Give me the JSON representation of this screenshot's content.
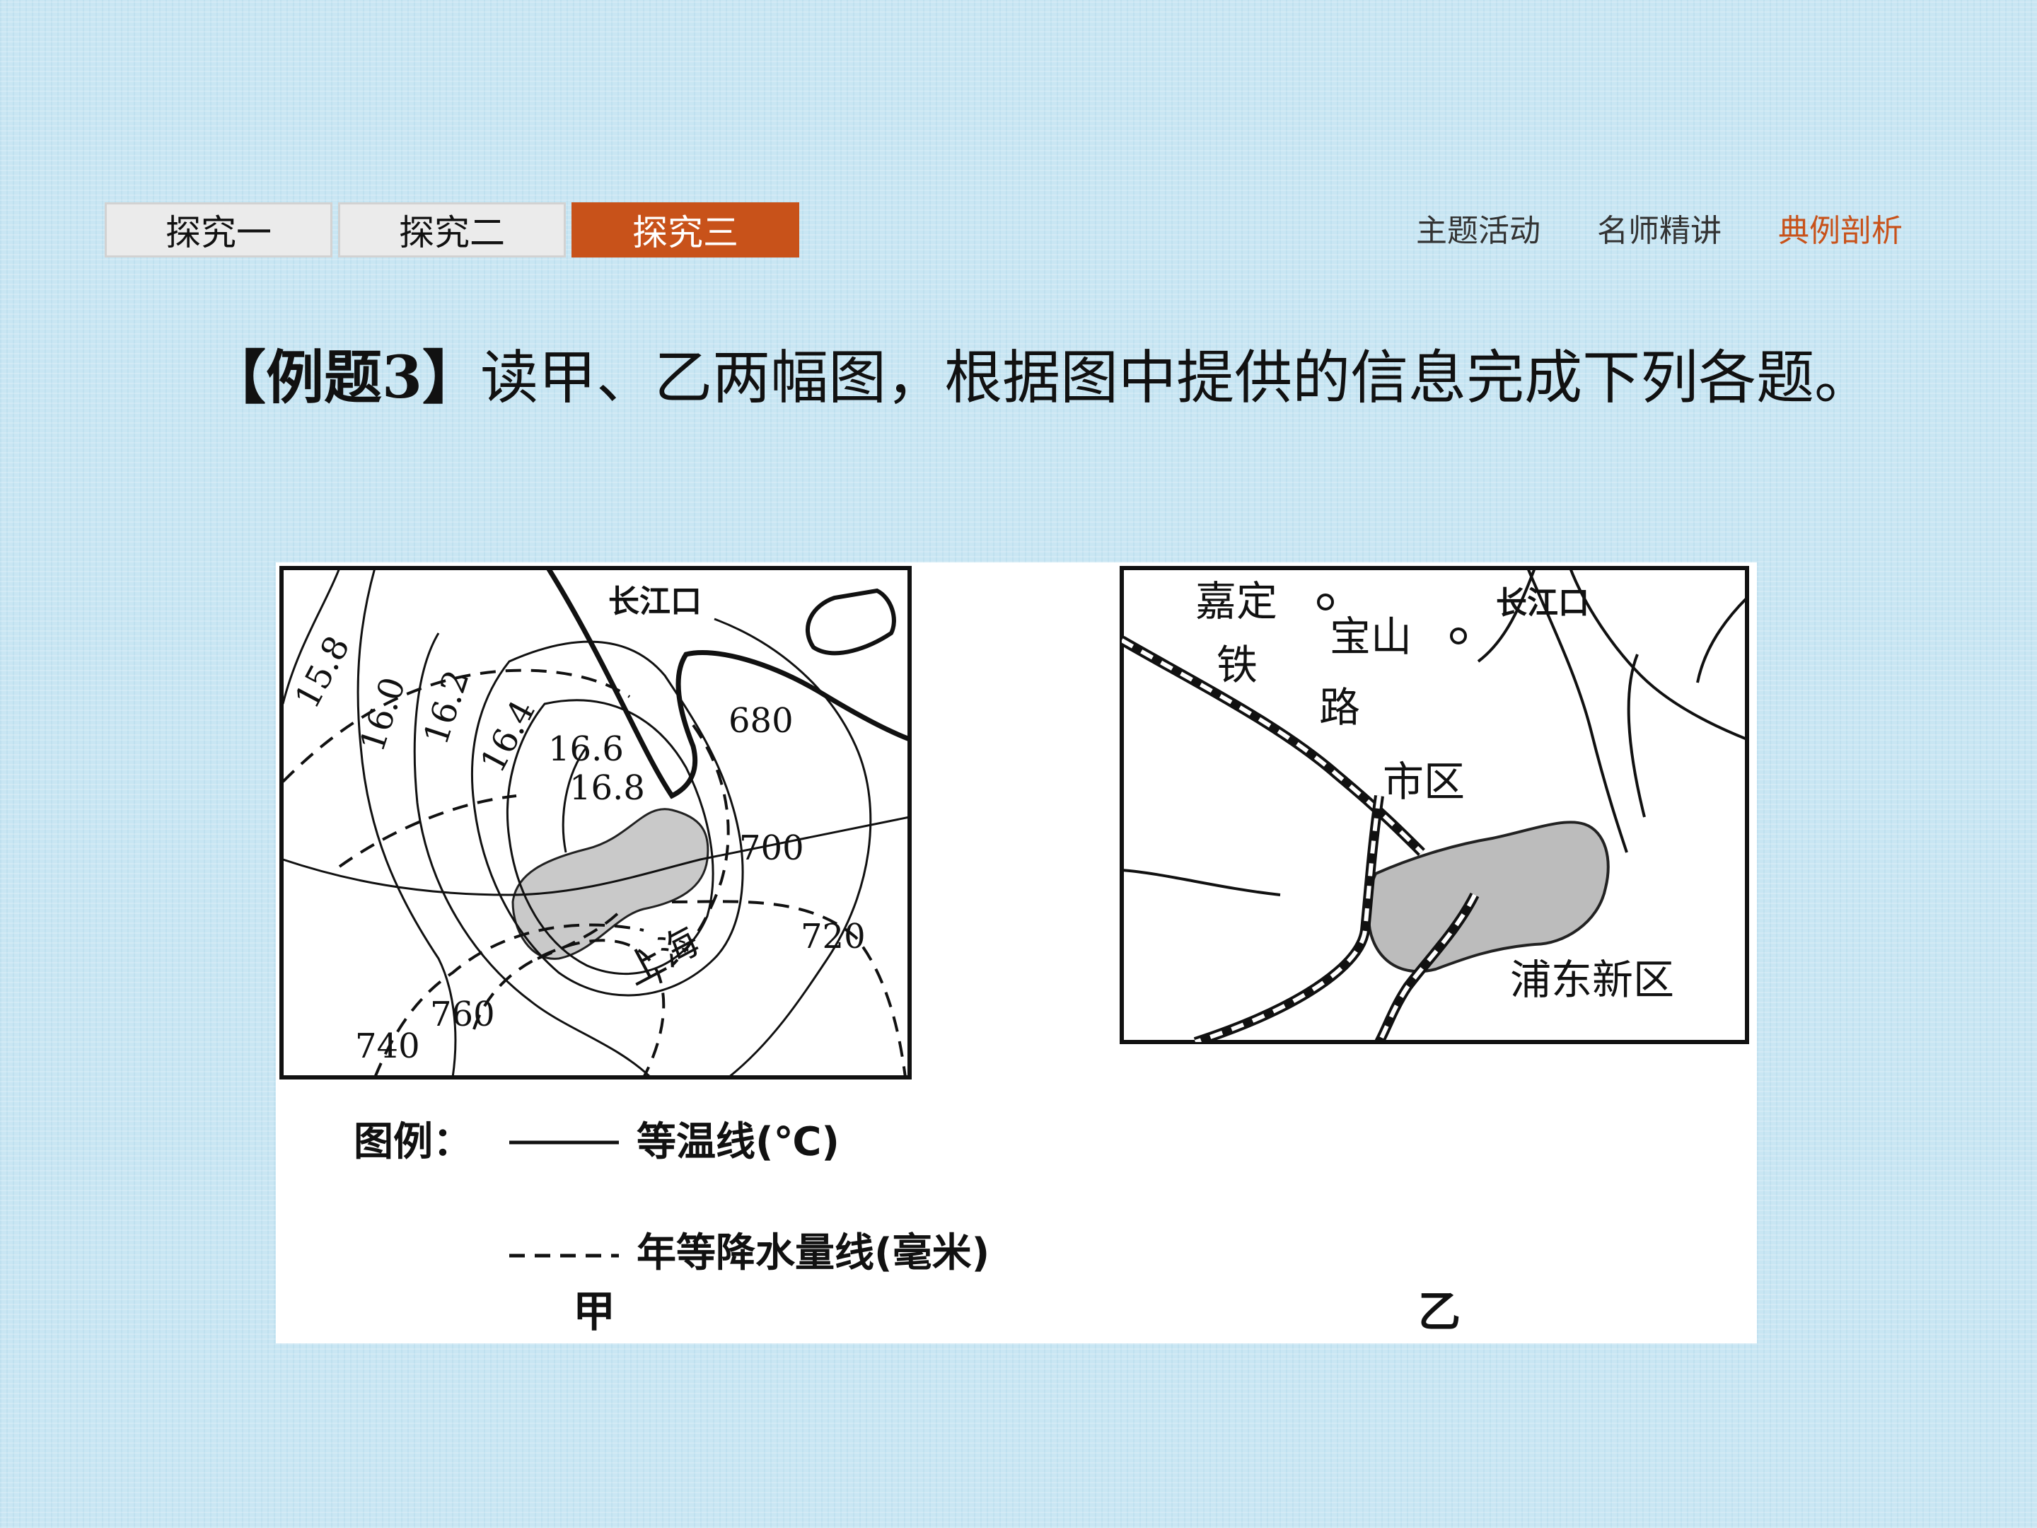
{
  "nav": {
    "tabs": [
      {
        "label": "探究一",
        "active": false
      },
      {
        "label": "探究二",
        "active": false
      },
      {
        "label": "探究三",
        "active": true
      }
    ],
    "links": [
      {
        "label": "主题活动",
        "active": false
      },
      {
        "label": "名师精讲",
        "active": false
      },
      {
        "label": "典例剖析",
        "active": true
      }
    ],
    "accent_color": "#c8521a"
  },
  "question": {
    "prefix": "【例题3】",
    "text": "读甲、乙两幅图，根据图中提供的信息完成下列各题。"
  },
  "map_jia": {
    "caption": "甲",
    "place_labels": {
      "estuary": "长江口",
      "city": "上海"
    },
    "isotherm_labels": [
      "15.8",
      "16.0",
      "16.2",
      "16.4",
      "16.6",
      "16.8"
    ],
    "isohyet_labels": [
      "680",
      "700",
      "720",
      "740",
      "760"
    ]
  },
  "legend": {
    "title": "图例：",
    "solid_label": "等温线(℃)",
    "dashed_label": "年等降水量线(毫米)"
  },
  "map_yi": {
    "caption": "乙",
    "place_labels": {
      "estuary": "长江口",
      "jiading": "嘉定",
      "baoshan": "宝山",
      "railway_1": "铁",
      "railway_2": "路",
      "urban": "市区",
      "pudong": "浦东新区"
    }
  }
}
